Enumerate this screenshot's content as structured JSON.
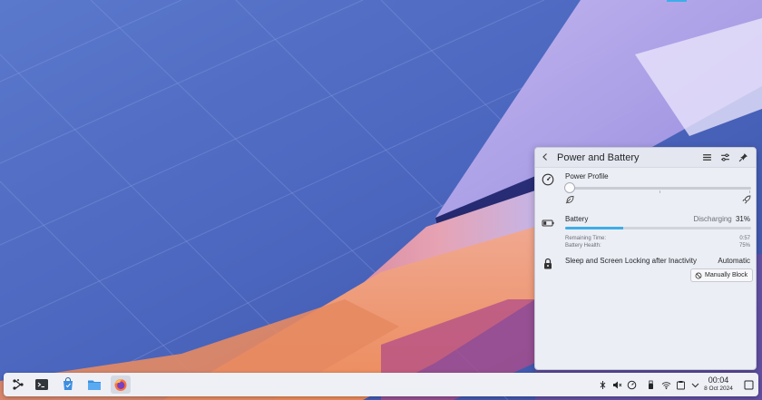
{
  "popup": {
    "title": "Power and Battery",
    "back_icon": "chevron-left-icon",
    "menu_icon": "hamburger-icon",
    "configure_icon": "sliders-icon",
    "pin_icon": "pin-icon",
    "power_profile": {
      "label": "Power Profile",
      "level": 0,
      "left_icon": "leaf-icon",
      "right_icon": "rocket-icon"
    },
    "battery": {
      "label": "Battery",
      "status": "Discharging",
      "percent_text": "31%",
      "percent": 31,
      "remaining_label": "Remaining Time:",
      "remaining_value": "0:57",
      "health_label": "Battery Health:",
      "health_value": "75%"
    },
    "sleep": {
      "label": "Sleep and Screen Locking after Inactivity",
      "value": "Automatic",
      "button_label": "Manually Block"
    }
  },
  "taskbar": {
    "apps": [
      "application-launcher-icon",
      "terminal-icon",
      "discover-icon",
      "file-manager-icon",
      "firefox-icon"
    ],
    "clock": {
      "time": "00:04",
      "date": "8 Oct 2024"
    }
  },
  "colors": {
    "accent": "#3daee9",
    "panel_bg": "#eceef5"
  }
}
